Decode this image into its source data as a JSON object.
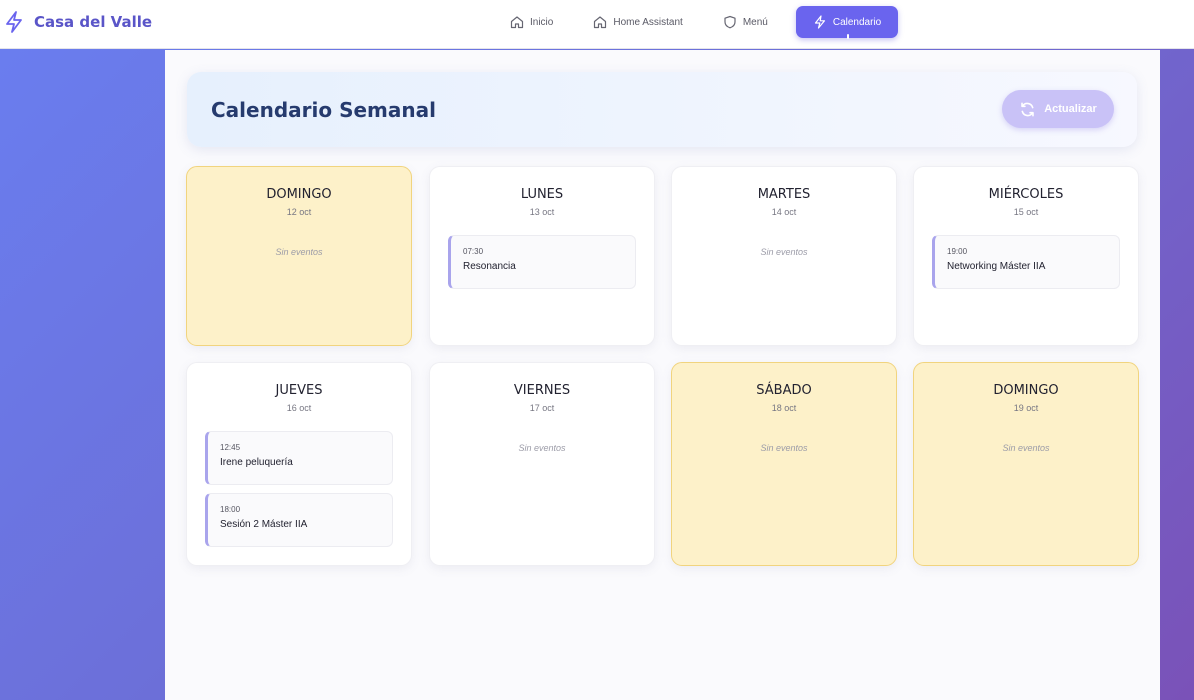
{
  "app": {
    "brand": "Casa del Valle"
  },
  "nav": [
    {
      "label": "Inicio",
      "icon": "home-icon",
      "active": false
    },
    {
      "label": "Home Assistant",
      "icon": "home-icon",
      "active": false
    },
    {
      "label": "Menú",
      "icon": "shield-icon",
      "active": false
    },
    {
      "label": "Calendario",
      "icon": "lightning-icon",
      "active": true
    }
  ],
  "header": {
    "title": "Calendario Semanal",
    "refresh_label": "Actualizar"
  },
  "empty_label": "Sin eventos",
  "days": [
    {
      "name": "DOMINGO",
      "date": "12 oct",
      "weekend": true,
      "events": []
    },
    {
      "name": "LUNES",
      "date": "13 oct",
      "weekend": false,
      "events": [
        {
          "time": "07:30",
          "title": "Resonancia"
        }
      ]
    },
    {
      "name": "MARTES",
      "date": "14 oct",
      "weekend": false,
      "events": []
    },
    {
      "name": "MIÉRCOLES",
      "date": "15 oct",
      "weekend": false,
      "events": [
        {
          "time": "19:00",
          "title": "Networking Máster IIA"
        }
      ]
    },
    {
      "name": "JUEVES",
      "date": "16 oct",
      "weekend": false,
      "events": [
        {
          "time": "12:45",
          "title": "Irene peluquería"
        },
        {
          "time": "18:00",
          "title": "Sesión 2 Máster IIA"
        }
      ]
    },
    {
      "name": "VIERNES",
      "date": "17 oct",
      "weekend": false,
      "events": []
    },
    {
      "name": "SÁBADO",
      "date": "18 oct",
      "weekend": true,
      "events": []
    },
    {
      "name": "DOMINGO",
      "date": "19 oct",
      "weekend": true,
      "events": []
    }
  ],
  "colors": {
    "accent": "#6a64ee",
    "brand": "#5a55c8",
    "weekend_bg": "#fdf1c9",
    "weekend_border": "#f1d47e",
    "event_bar": "#a9a4ec",
    "title": "#263b6e"
  }
}
